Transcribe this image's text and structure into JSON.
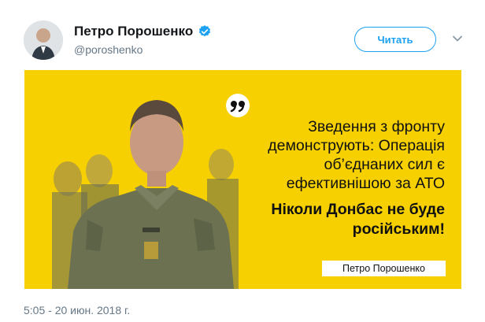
{
  "tweet": {
    "author_name": "Петро Порошенко",
    "handle": "@poroshenko",
    "follow_label": "Читать",
    "timestamp": "5:05 - 20 июн. 2018 г."
  },
  "media": {
    "quote_lines": [
      "Зведення з фронту",
      "демонструють: Операція",
      "об’єднаних сил є",
      "ефективнішою за АТО"
    ],
    "bold_lines": [
      "Ніколи Донбас не буде",
      "російським!"
    ],
    "signature": "Петро Порошенко"
  },
  "colors": {
    "brand_blue": "#1da1f2",
    "card_yellow": "#f6d000",
    "muted_text": "#657786"
  },
  "icons": {
    "verified": "verified-badge-icon",
    "chevron": "chevron-down-icon",
    "quote": "quote-icon"
  }
}
